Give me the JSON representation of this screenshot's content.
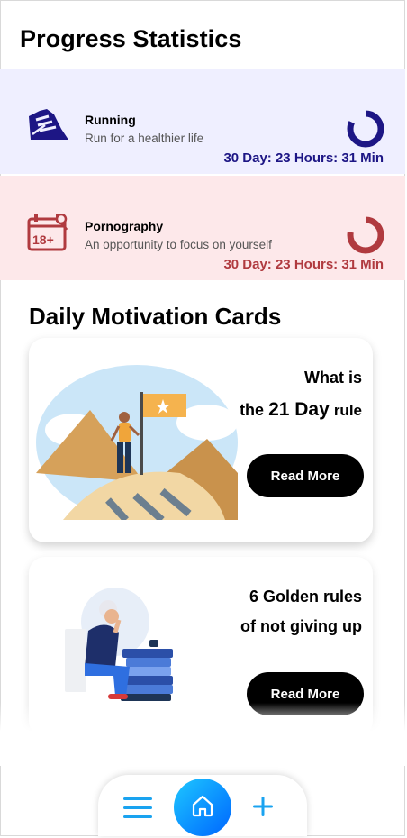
{
  "header": {
    "title": "Progress Statistics"
  },
  "stats": [
    {
      "name": "Running",
      "subtitle": "Run for a healthier life",
      "time": "30 Day: 23 Hours: 31 Min",
      "icon": "running-shoe-icon",
      "accent": "#1d1685",
      "background": "#efefff",
      "progress": 0.82
    },
    {
      "name": "Pornography",
      "subtitle": "An opportunity to focus on yourself",
      "time": "30 Day: 23 Hours: 31 Min",
      "icon": "adult-calendar-icon",
      "accent": "#b03a3f",
      "background": "#fde8ea",
      "progress": 0.78
    }
  ],
  "motivation": {
    "title": "Daily Motivation Cards",
    "cards": [
      {
        "title_line1": "What is",
        "title_pre": "the",
        "title_big": "21 Day",
        "title_post": "rule",
        "button": "Read More",
        "illustration": "mountain-flag-illustration"
      },
      {
        "title_line1": "6 Golden rules",
        "title_line2": "of not giving up",
        "button": "Read More",
        "illustration": "thinking-woman-books-illustration"
      }
    ]
  },
  "nav": {
    "menu_icon": "hamburger-menu-icon",
    "home_icon": "home-icon",
    "add_icon": "plus-icon",
    "accent": "#0a8cff"
  }
}
